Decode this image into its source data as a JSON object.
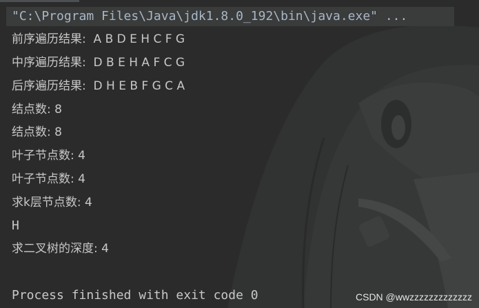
{
  "console": {
    "command": "\"C:\\Program Files\\Java\\jdk1.8.0_192\\bin\\java.exe\" ...",
    "output": [
      "前序遍历结果:  A B D E H C F G",
      "中序遍历结果:  D B E H A F C G",
      "后序遍历结果:  D H E B F G C A",
      "结点数: 8",
      "结点数: 8",
      "叶子节点数: 4",
      "叶子节点数: 4",
      "求k层节点数: 4",
      "H",
      "求二叉树的深度: 4",
      "",
      "Process finished with exit code 0"
    ]
  },
  "watermark": "CSDN @wwzzzzzzzzzzzzz",
  "colors": {
    "background": "#2b2b2b",
    "command_highlight": "#3a3b3b",
    "text": "#c8c8c8",
    "command_text": "#a9b7c6"
  }
}
